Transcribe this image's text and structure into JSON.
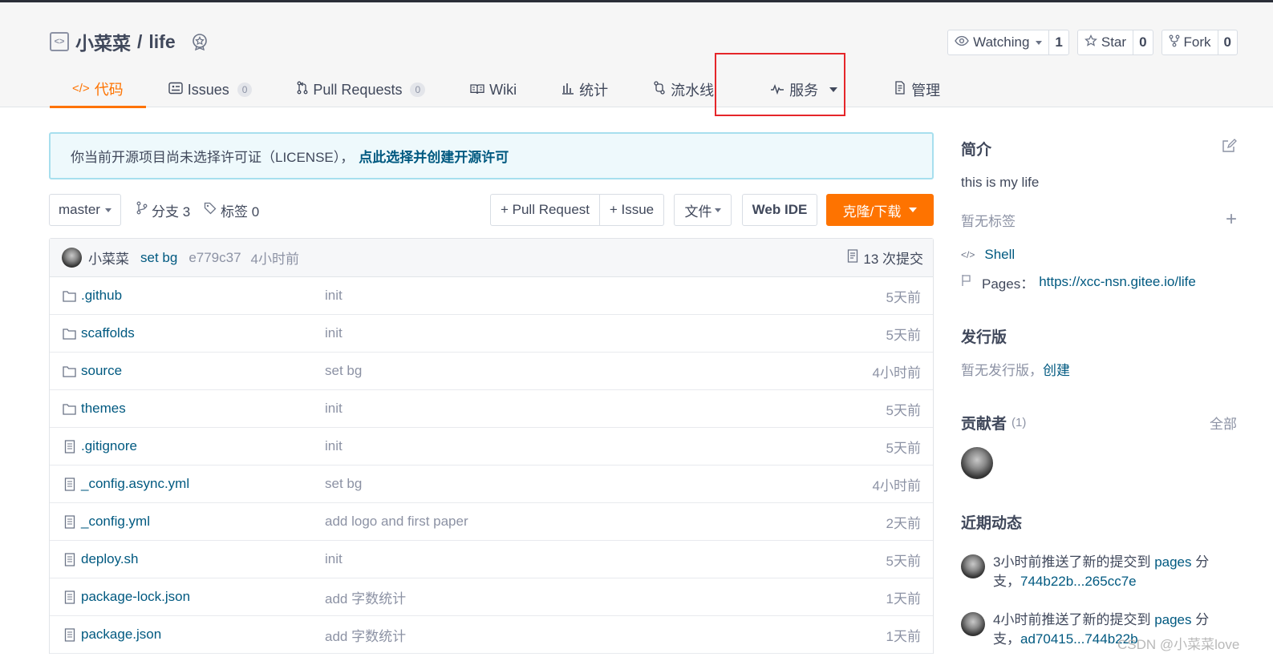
{
  "repo": {
    "owner": "小菜菜",
    "separator": "/",
    "name": "life"
  },
  "counters": {
    "watch": {
      "label": "Watching",
      "count": "1"
    },
    "star": {
      "label": "Star",
      "count": "0"
    },
    "fork": {
      "label": "Fork",
      "count": "0"
    }
  },
  "tabs": [
    {
      "label": "代码",
      "icon": "code-icon",
      "active": true
    },
    {
      "label": "Issues",
      "count": "0",
      "icon": "issues-icon"
    },
    {
      "label": "Pull Requests",
      "count": "0",
      "icon": "pull-request-icon"
    },
    {
      "label": "Wiki",
      "icon": "book-icon"
    },
    {
      "label": "统计",
      "icon": "bar-chart-icon"
    },
    {
      "label": "流水线",
      "icon": "pipeline-icon"
    },
    {
      "label": "服务",
      "icon": "activity-icon",
      "dropdown": true
    },
    {
      "label": "管理",
      "icon": "settings-doc-icon"
    }
  ],
  "license": {
    "text": "你当前开源项目尚未选择许可证（LICENSE），",
    "link": "点此选择并创建开源许可"
  },
  "toolbar": {
    "branch": "master",
    "branches_label": "分支 3",
    "tags_label": "标签 0",
    "pr_button": "+ Pull Request",
    "issue_button": "+ Issue",
    "file_button": "文件",
    "webide_button": "Web IDE",
    "clone_button": "克隆/下载"
  },
  "commit": {
    "author": "小菜菜",
    "message": "set bg",
    "hash": "e779c37",
    "time": "4小时前",
    "count_label": "13 次提交"
  },
  "files": [
    {
      "name": ".github",
      "type": "folder",
      "message": "init",
      "time": "5天前"
    },
    {
      "name": "scaffolds",
      "type": "folder",
      "message": "init",
      "time": "5天前"
    },
    {
      "name": "source",
      "type": "folder",
      "message": "set bg",
      "time": "4小时前"
    },
    {
      "name": "themes",
      "type": "folder",
      "message": "init",
      "time": "5天前"
    },
    {
      "name": ".gitignore",
      "type": "file",
      "message": "init",
      "time": "5天前"
    },
    {
      "name": "_config.async.yml",
      "type": "file",
      "message": "set bg",
      "time": "4小时前"
    },
    {
      "name": "_config.yml",
      "type": "file",
      "message": "add logo and first paper",
      "time": "2天前"
    },
    {
      "name": "deploy.sh",
      "type": "file",
      "message": "init",
      "time": "5天前"
    },
    {
      "name": "package-lock.json",
      "type": "file",
      "message": "add 字数统计",
      "time": "1天前"
    },
    {
      "name": "package.json",
      "type": "file",
      "message": "add 字数统计",
      "time": "1天前"
    }
  ],
  "sidebar": {
    "intro_title": "简介",
    "description": "this is my life",
    "no_tags": "暂无标签",
    "language": "Shell",
    "pages_label": "Pages：",
    "pages_url": "https://xcc-nsn.gitee.io/life",
    "release_title": "发行版",
    "no_release": "暂无发行版，",
    "create_link": "创建",
    "contributors_title": "贡献者",
    "contributors_count": "(1)",
    "all_link": "全部",
    "activity_title": "近期动态",
    "activities": [
      {
        "prefix": "3小时前推送了新的提交到 ",
        "branch": "pages",
        "mid": " 分支，",
        "range": "744b22b...265cc7e"
      },
      {
        "prefix": "4小时前推送了新的提交到 ",
        "branch": "pages",
        "mid": " 分支，",
        "range": "ad70415...744b22b"
      }
    ]
  },
  "watermark": "CSDN @小菜菜love",
  "colors": {
    "accent": "#fe7300",
    "link": "#005980",
    "highlight": "#e5262a"
  }
}
